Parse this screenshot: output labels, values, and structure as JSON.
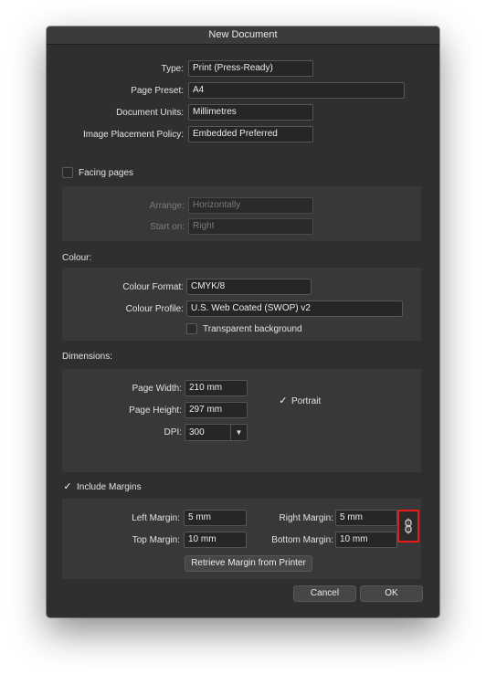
{
  "window": {
    "title": "New Document"
  },
  "general": {
    "type_label": "Type:",
    "type_value": "Print (Press-Ready)",
    "preset_label": "Page Preset:",
    "preset_value": "A4",
    "units_label": "Document Units:",
    "units_value": "Millimetres",
    "placement_label": "Image Placement Policy:",
    "placement_value": "Embedded Preferred"
  },
  "facing": {
    "checkbox_label": "Facing pages",
    "checked": false,
    "arrange_label": "Arrange:",
    "arrange_value": "Horizontally",
    "start_label": "Start on:",
    "start_value": "Right"
  },
  "colour": {
    "section_label": "Colour:",
    "format_label": "Colour Format:",
    "format_value": "CMYK/8",
    "profile_label": "Colour Profile:",
    "profile_value": "U.S. Web Coated (SWOP) v2",
    "transparent_label": "Transparent background",
    "transparent_checked": false
  },
  "dimensions": {
    "section_label": "Dimensions:",
    "width_label": "Page Width:",
    "width_value": "210 mm",
    "height_label": "Page Height:",
    "height_value": "297 mm",
    "dpi_label": "DPI:",
    "dpi_value": "300",
    "portrait_label": "Portrait",
    "portrait_checked": true
  },
  "margins": {
    "include_label": "Include Margins",
    "include_checked": true,
    "left_label": "Left Margin:",
    "left_value": "5 mm",
    "right_label": "Right Margin:",
    "right_value": "5 mm",
    "top_label": "Top Margin:",
    "top_value": "10 mm",
    "bottom_label": "Bottom Margin:",
    "bottom_value": "10 mm",
    "retrieve_label": "Retrieve Margin from Printer"
  },
  "footer": {
    "cancel_label": "Cancel",
    "ok_label": "OK"
  },
  "colors": {
    "highlight": "#e51b1b",
    "panel": "#383838",
    "dialog": "#2f2f2f"
  }
}
